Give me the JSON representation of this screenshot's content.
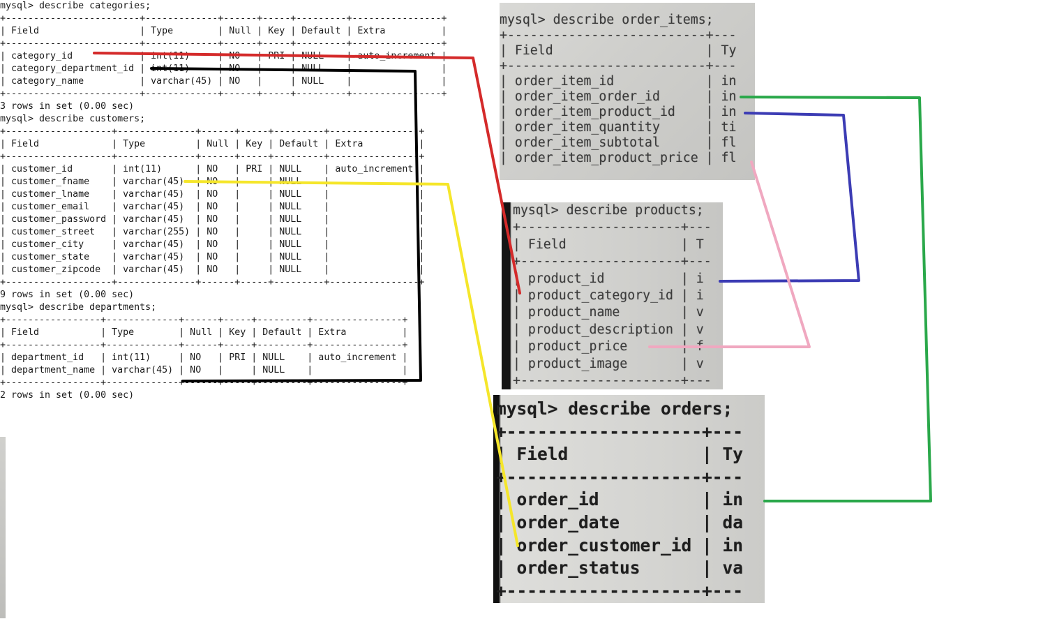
{
  "terminal": {
    "categories": "mysql> describe categories;\n+------------------------+-------------+------+-----+---------+----------------+\n| Field                  | Type        | Null | Key | Default | Extra          |\n+------------------------+-------------+------+-----+---------+----------------+\n| category_id            | int(11)     | NO   | PRI | NULL    | auto_increment |\n| category_department_id | int(11)     | NO   |     | NULL    |                |\n| category_name          | varchar(45) | NO   |     | NULL    |                |\n+------------------------+-------------+------+-----+---------+----------------+\n3 rows in set (0.00 sec)\n",
    "customers": "mysql> describe customers;\n+-------------------+--------------+------+-----+---------+----------------+\n| Field             | Type         | Null | Key | Default | Extra          |\n+-------------------+--------------+------+-----+---------+----------------+\n| customer_id       | int(11)      | NO   | PRI | NULL    | auto_increment |\n| customer_fname    | varchar(45)  | NO   |     | NULL    |                |\n| customer_lname    | varchar(45)  | NO   |     | NULL    |                |\n| customer_email    | varchar(45)  | NO   |     | NULL    |                |\n| customer_password | varchar(45)  | NO   |     | NULL    |                |\n| customer_street   | varchar(255) | NO   |     | NULL    |                |\n| customer_city     | varchar(45)  | NO   |     | NULL    |                |\n| customer_state    | varchar(45)  | NO   |     | NULL    |                |\n| customer_zipcode  | varchar(45)  | NO   |     | NULL    |                |\n+-------------------+--------------+------+-----+---------+----------------+\n9 rows in set (0.00 sec)\n",
    "departments": "mysql> describe departments;\n+-----------------+-------------+------+-----+---------+----------------+\n| Field           | Type        | Null | Key | Default | Extra          |\n+-----------------+-------------+------+-----+---------+----------------+\n| department_id   | int(11)     | NO   | PRI | NULL    | auto_increment |\n| department_name | varchar(45) | NO   |     | NULL    |                |\n+-----------------+-------------+------+-----+---------+----------------+\n2 rows in set (0.00 sec)"
  },
  "photos": {
    "order_items": "mysql> describe order_items;\n+--------------------------+---\n| Field                    | Ty\n+--------------------------+---\n| order_item_id            | in\n| order_item_order_id      | in\n| order_item_product_id    | in\n| order_item_quantity      | ti\n| order_item_subtotal      | fl\n| order_item_product_price | fl",
    "products": "mysql> describe products;\n+---------------------+---\n| Field               | T\n+---------------------+---\n| product_id          | i\n| product_category_id | i\n| product_name        | v\n| product_description | v\n| product_price       | f\n| product_image       | v\n+---------------------+---",
    "orders": "mysql> describe orders;\n+-------------------+---\n| Field             | Ty\n+-------------------+---\n| order_id          | in\n| order_date        | da\n| order_customer_id | in\n| order_status      | va\n+-------------------+---"
  },
  "connector_colors": {
    "category_to_product": "#d42a2a",
    "department_link": "#000000",
    "customer_to_order": "#f5e62a",
    "order_to_order_item": "#2aa84a",
    "product_to_order_item": "#3c3cb4",
    "price_link": "#f0a8c0"
  }
}
